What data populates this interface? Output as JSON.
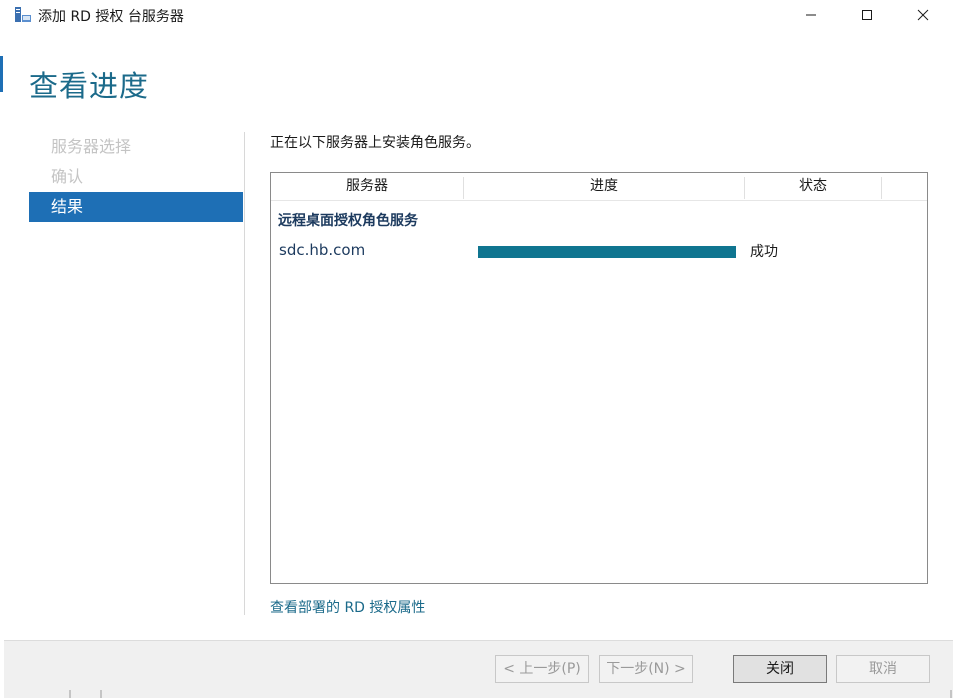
{
  "window": {
    "title": "添加 RD 授权 台服务器",
    "controls": {
      "minimize": "minimize-icon",
      "maximize": "maximize-icon",
      "close": "close-icon"
    }
  },
  "page": {
    "title": "查看进度"
  },
  "nav": {
    "items": [
      {
        "label": "服务器选择",
        "state": "disabled"
      },
      {
        "label": "确认",
        "state": "disabled"
      },
      {
        "label": "结果",
        "state": "active"
      }
    ]
  },
  "main": {
    "intro": "正在以下服务器上安装角色服务。",
    "table": {
      "columns": [
        "服务器",
        "进度",
        "状态"
      ],
      "group_title": "远程桌面授权角色服务",
      "rows": [
        {
          "server": "sdc.hb.com",
          "progress": 1.0,
          "status": "成功"
        }
      ]
    },
    "link": "查看部署的 RD 授权属性"
  },
  "footer": {
    "prev": "< 上一步(P)",
    "next": "下一步(N) >",
    "close": "关闭",
    "cancel": "取消"
  },
  "colors": {
    "accent": "#1e6fb5",
    "title": "#1b6a8a",
    "progress": "#0f7590"
  }
}
